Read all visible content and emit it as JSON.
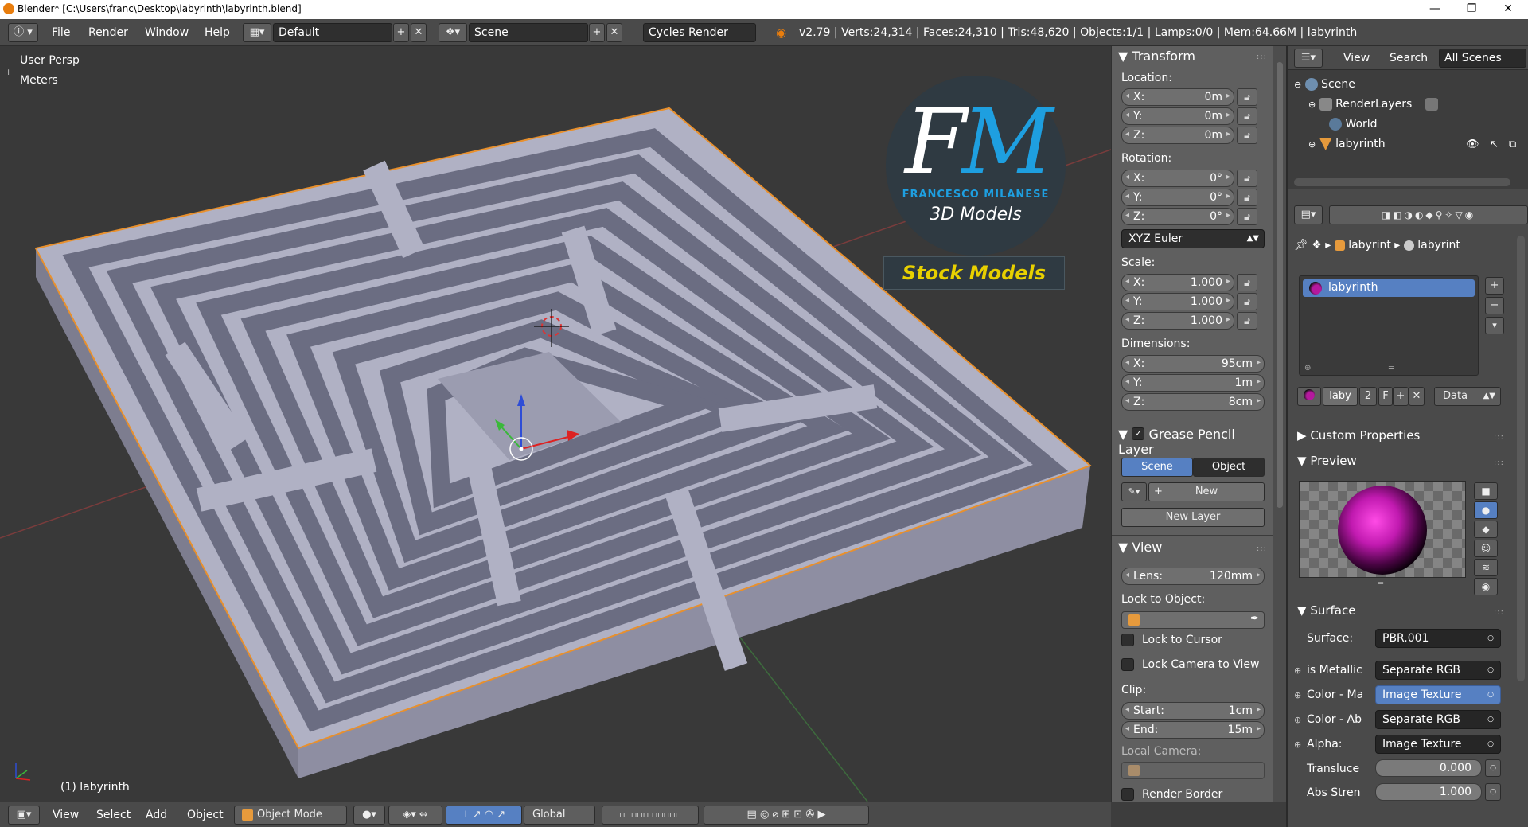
{
  "window": {
    "title": "Blender* [C:\\Users\\franc\\Desktop\\labyrinth\\labyrinth.blend]",
    "minimize": "—",
    "maximize": "❐",
    "close": "✕"
  },
  "topbar": {
    "menus": [
      "File",
      "Render",
      "Window",
      "Help"
    ],
    "screen_layout": "Default",
    "scene": "Scene",
    "render_engine": "Cycles Render",
    "stats": "v2.79 | Verts:24,314 | Faces:24,310 | Tris:48,620 | Objects:1/1 | Lamps:0/0 | Mem:64.66M | labyrinth"
  },
  "viewport": {
    "view_name": "User Persp",
    "units": "Meters",
    "object_label": "(1) labyrinth",
    "watermark": {
      "monogram": "FM",
      "author": "FRANCESCO MILANESE",
      "subtitle": "3D Models",
      "tag": "Stock Models"
    }
  },
  "bottombar": {
    "menus": [
      "View",
      "Select",
      "Add",
      "Object"
    ],
    "mode": "Object Mode",
    "orientation": "Global"
  },
  "transform": {
    "title": "Transform",
    "location_label": "Location:",
    "location": [
      {
        "k": "X:",
        "v": "0m"
      },
      {
        "k": "Y:",
        "v": "0m"
      },
      {
        "k": "Z:",
        "v": "0m"
      }
    ],
    "rotation_label": "Rotation:",
    "rotation": [
      {
        "k": "X:",
        "v": "0°"
      },
      {
        "k": "Y:",
        "v": "0°"
      },
      {
        "k": "Z:",
        "v": "0°"
      }
    ],
    "rotation_mode": "XYZ Euler",
    "scale_label": "Scale:",
    "scale": [
      {
        "k": "X:",
        "v": "1.000"
      },
      {
        "k": "Y:",
        "v": "1.000"
      },
      {
        "k": "Z:",
        "v": "1.000"
      }
    ],
    "dimensions_label": "Dimensions:",
    "dimensions": [
      {
        "k": "X:",
        "v": "95cm"
      },
      {
        "k": "Y:",
        "v": "1m"
      },
      {
        "k": "Z:",
        "v": "8cm"
      }
    ]
  },
  "grease_pencil": {
    "title": "Grease Pencil Layer",
    "tab_scene": "Scene",
    "tab_object": "Object",
    "new": "New",
    "new_layer": "New Layer"
  },
  "view_panel": {
    "title": "View",
    "lens_label": "Lens:",
    "lens_value": "120mm",
    "lock_to_object": "Lock to Object:",
    "lock_to_cursor": "Lock to Cursor",
    "lock_camera": "Lock Camera to View",
    "clip_label": "Clip:",
    "clip_start_label": "Start:",
    "clip_start": "1cm",
    "clip_end_label": "End:",
    "clip_end": "15m",
    "local_camera": "Local Camera:",
    "render_border": "Render Border"
  },
  "outliner": {
    "view": "View",
    "search": "Search",
    "filter": "All Scenes",
    "items": [
      "Scene",
      "RenderLayers",
      "World",
      "labyrinth"
    ]
  },
  "properties": {
    "breadcrumb_object": "labyrint",
    "breadcrumb_material": "labyrint",
    "material_slot": "labyrinth",
    "material_name": "laby",
    "users": "2",
    "fake_user": "F",
    "link": "Data",
    "custom_properties": "Custom Properties",
    "preview": "Preview",
    "surface": "Surface",
    "surface_label": "Surface:",
    "surface_value": "PBR.001",
    "inputs": [
      {
        "label": "is Metallic",
        "value": "Separate RGB",
        "hi": false
      },
      {
        "label": "Color - Ma",
        "value": "Image Texture",
        "hi": true
      },
      {
        "label": "Color - Ab",
        "value": "Separate RGB",
        "hi": false
      },
      {
        "label": "Alpha:",
        "value": "Image Texture",
        "hi": false
      }
    ],
    "transluce_label": "Transluce",
    "transluce_value": "0.000",
    "abs_label": "Abs Stren",
    "abs_value": "1.000"
  },
  "colors": {
    "accent": "#5680c2",
    "maze": "#a7a8bc",
    "material": "#b5199e"
  }
}
